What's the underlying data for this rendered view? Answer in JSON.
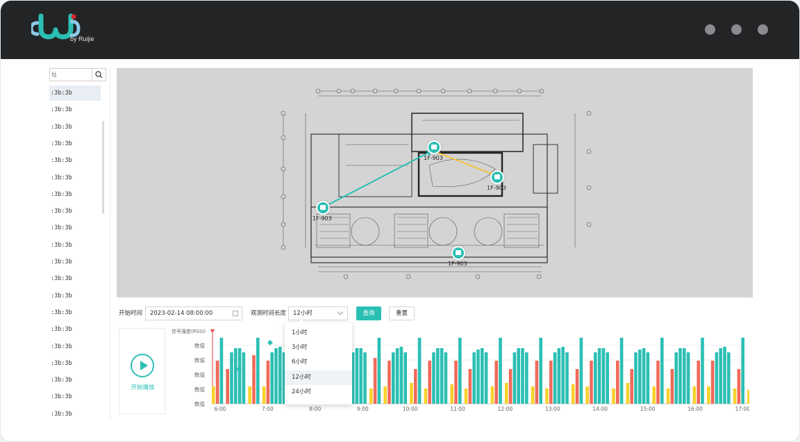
{
  "brand": {
    "logo_alt": "Wi",
    "subtitle": "by Ruijie",
    "colors": {
      "teal": "#2bbfb4",
      "red": "#d9262f",
      "gray": "#8a8c8f"
    }
  },
  "window_controls": [
    {
      "icon": "dot-icon"
    },
    {
      "icon": "dot-icon"
    },
    {
      "icon": "dot-icon"
    }
  ],
  "sidebar": {
    "search_placeholder": "址",
    "items": [
      ":3b:3b",
      ":3b:3b",
      ":3b:3b",
      ":3b:3b",
      ":3b:3b",
      ":3b:3b",
      ":3b:3b",
      ":3b:3b",
      ":3b:3b",
      ":3b:3b",
      ":3b:3b",
      ":3b:3b",
      ":3b:3b",
      ":3b:3b",
      ":3b:3b",
      ":3b:3b",
      ":3b:3b",
      ":3b:3b",
      ":3b:3b",
      ":3b:3b"
    ],
    "active_index": 0
  },
  "map": {
    "markers": [
      {
        "label": "1F-903"
      },
      {
        "label": "1F-903"
      },
      {
        "label": "1F-903"
      },
      {
        "label": "1F-903"
      }
    ]
  },
  "controls": {
    "start_time_label": "开始时间",
    "start_time_value": "2023-02-14   08:00:00",
    "duration_label": "观测时间长度",
    "duration_value": "12小时",
    "query_label": "查询",
    "reset_label": "重置"
  },
  "dropdown": {
    "options": [
      "1小时",
      "3小时",
      "6小时",
      "12小时",
      "24小时"
    ],
    "selected_index": 3
  },
  "player": {
    "label": "开始播放"
  },
  "chart_data": {
    "type": "bar",
    "ylabel": "信号强度(RSSI)",
    "y_tick_labels": [
      "数值",
      "数值",
      "数值",
      "数值",
      "数值"
    ],
    "x_tick_labels": [
      "6:00",
      "7:00",
      "8:00",
      "9:00",
      "10:00",
      "11:00",
      "12:00",
      "13:00",
      "14:00",
      "15:00",
      "16:00",
      "17:00"
    ],
    "series_colors": {
      "teal": "#2bbfb4",
      "red": "#f06a5a",
      "yellow": "#f7d22a"
    },
    "groups": [
      {
        "yellow": 0.25,
        "red": 0.62,
        "teal": [
          0.95
        ]
      },
      {
        "yellow": 0.0,
        "red": 0.5,
        "teal": [
          0.74,
          0.8,
          0.8,
          0.74
        ]
      },
      {
        "yellow": 0.25,
        "red": 0.7,
        "teal": [
          0.95
        ]
      },
      {
        "yellow": 0.25,
        "red": 0.62,
        "teal": [
          0.74,
          0.8,
          0.82,
          0.74
        ]
      },
      {
        "yellow": 0.28,
        "red": 0.62,
        "teal": [
          0.95
        ]
      },
      {
        "yellow": 0.3,
        "red": 0.5,
        "teal": [
          0.74,
          0.78,
          0.8,
          0.74
        ]
      },
      {
        "yellow": 0.22,
        "red": 0.62,
        "teal": [
          0.95
        ]
      },
      {
        "yellow": 0.3,
        "red": 0.5,
        "teal": [
          0.74,
          0.8,
          0.8,
          0.74
        ]
      },
      {
        "yellow": 0.22,
        "red": 0.66,
        "teal": [
          0.95
        ]
      },
      {
        "yellow": 0.25,
        "red": 0.62,
        "teal": [
          0.74,
          0.8,
          0.82,
          0.74
        ]
      },
      {
        "yellow": 0.3,
        "red": 0.5,
        "teal": [
          0.95
        ]
      },
      {
        "yellow": 0.22,
        "red": 0.62,
        "teal": [
          0.74,
          0.8,
          0.8,
          0.74
        ]
      },
      {
        "yellow": 0.28,
        "red": 0.62,
        "teal": [
          0.95
        ]
      },
      {
        "yellow": 0.22,
        "red": 0.5,
        "teal": [
          0.74,
          0.78,
          0.8,
          0.74
        ]
      },
      {
        "yellow": 0.25,
        "red": 0.62,
        "teal": [
          0.95
        ]
      },
      {
        "yellow": 0.3,
        "red": 0.5,
        "teal": [
          0.74,
          0.8,
          0.8,
          0.74
        ]
      },
      {
        "yellow": 0.25,
        "red": 0.62,
        "teal": [
          0.95
        ]
      },
      {
        "yellow": 0.22,
        "red": 0.62,
        "teal": [
          0.74,
          0.8,
          0.82,
          0.74
        ]
      },
      {
        "yellow": 0.28,
        "red": 0.5,
        "teal": [
          0.95
        ]
      },
      {
        "yellow": 0.25,
        "red": 0.62,
        "teal": [
          0.74,
          0.8,
          0.8,
          0.74
        ]
      },
      {
        "yellow": 0.22,
        "red": 0.62,
        "teal": [
          0.95
        ]
      },
      {
        "yellow": 0.3,
        "red": 0.5,
        "teal": [
          0.74,
          0.78,
          0.8,
          0.74
        ]
      },
      {
        "yellow": 0.25,
        "red": 0.62,
        "teal": [
          0.95
        ]
      },
      {
        "yellow": 0.22,
        "red": 0.5,
        "teal": [
          0.74,
          0.8,
          0.8,
          0.74
        ]
      },
      {
        "yellow": 0.25,
        "red": 0.62,
        "teal": [
          0.95
        ]
      },
      {
        "yellow": 0.25,
        "red": 0.62,
        "teal": [
          0.74,
          0.8,
          0.82,
          0.74
        ]
      },
      {
        "yellow": 0.22,
        "red": 0.5,
        "teal": [
          0.95
        ]
      },
      {
        "yellow": 0.2,
        "red": 0.5,
        "teal": [
          0.74,
          0.95,
          0.78,
          0.74
        ]
      },
      {
        "yellow": 0.0,
        "red": 0.62,
        "teal": [
          0.8,
          0.8,
          0.8,
          0.74
        ]
      }
    ]
  }
}
